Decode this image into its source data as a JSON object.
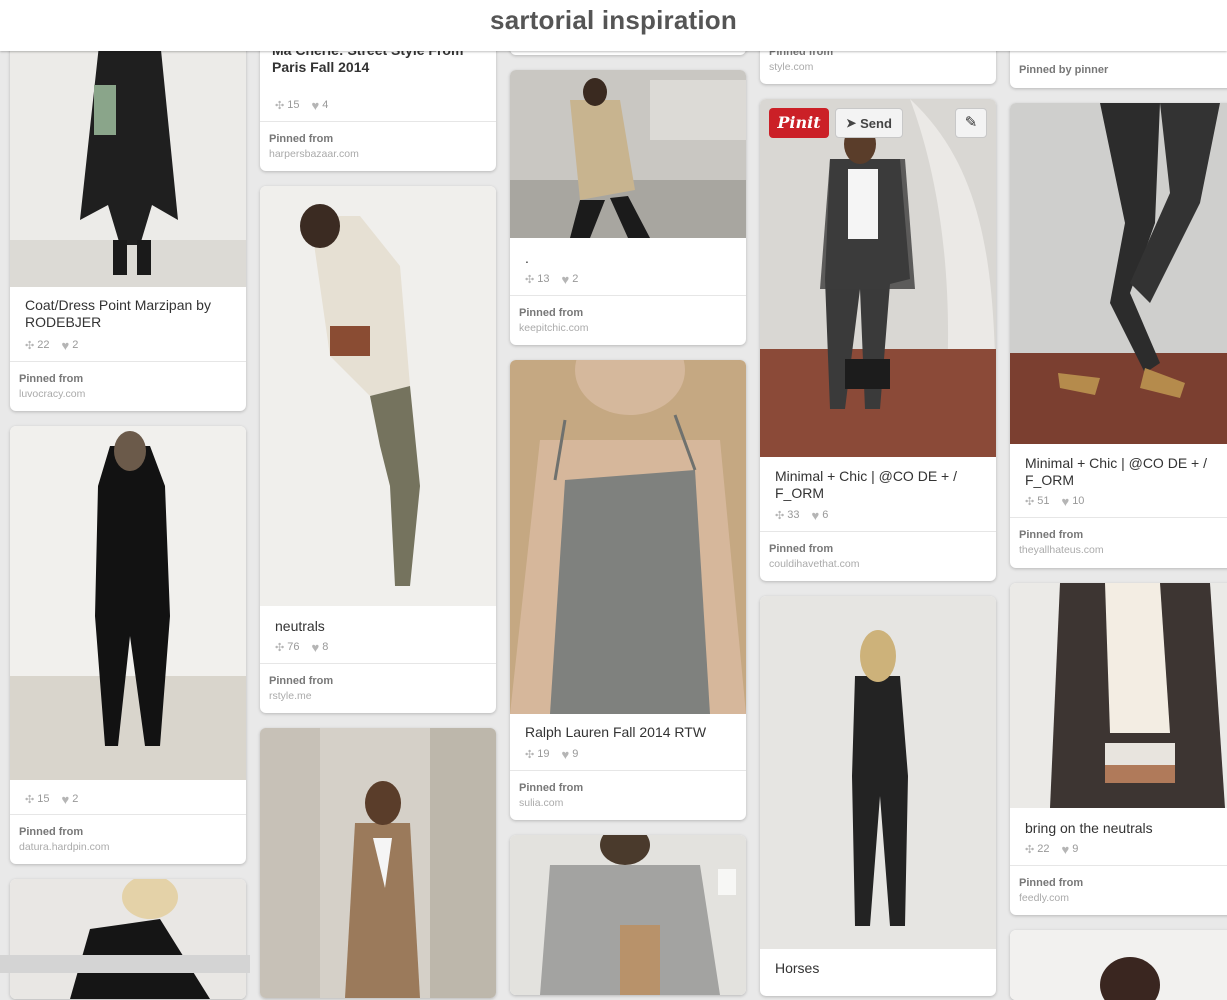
{
  "board": {
    "title": "sartorial inspiration"
  },
  "icons": {
    "repin": "repin-icon",
    "like": "heart-icon",
    "send": "paper-plane-icon",
    "edit": "pencil-icon"
  },
  "pin_actions": {
    "pinit_label": "Pinit",
    "send_label": "Send"
  },
  "pins": {
    "c1a": {
      "description": "Coat/Dress Point Marzipan by RODEBJER",
      "repins": "22",
      "likes": "2",
      "pinned_label": "Pinned from",
      "source": "luvocracy.com"
    },
    "c1b": {
      "repins": "15",
      "likes": "2",
      "pinned_label": "Pinned from",
      "source": "datura.hardpin.com"
    },
    "c2a": {
      "description": "Ma Cherie: Street Style From Paris Fall 2014",
      "repins": "15",
      "likes": "4",
      "pinned_label": "Pinned from",
      "source": "harpersbazaar.com"
    },
    "c2b": {
      "description": "neutrals",
      "repins": "76",
      "likes": "8",
      "pinned_label": "Pinned from",
      "source": "rstyle.me"
    },
    "c3b": {
      "description": ".",
      "repins": "13",
      "likes": "2",
      "pinned_label": "Pinned from",
      "source": "keepitchic.com"
    },
    "c3c": {
      "description": "Ralph Lauren Fall 2014 RTW",
      "repins": "19",
      "likes": "9",
      "pinned_label": "Pinned from",
      "source": "sulia.com"
    },
    "c4a": {
      "pinned_label": "Pinned from",
      "source": "style.com"
    },
    "c4b": {
      "description": "Minimal + Chic | @CO DE + / F_ORM",
      "repins": "33",
      "likes": "6",
      "pinned_label": "Pinned from",
      "source": "couldihavethat.com"
    },
    "c4c": {
      "description": "Horses"
    },
    "c5a": {
      "pinned_label": "Pinned by pinner"
    },
    "c5b": {
      "description": "Minimal + Chic | @CO DE + / F_ORM",
      "repins": "51",
      "likes": "10",
      "pinned_label": "Pinned from",
      "source": "theyallhateus.com"
    },
    "c5c": {
      "description": "bring on the neutrals",
      "repins": "22",
      "likes": "9",
      "pinned_label": "Pinned from",
      "source": "feedly.com"
    }
  }
}
